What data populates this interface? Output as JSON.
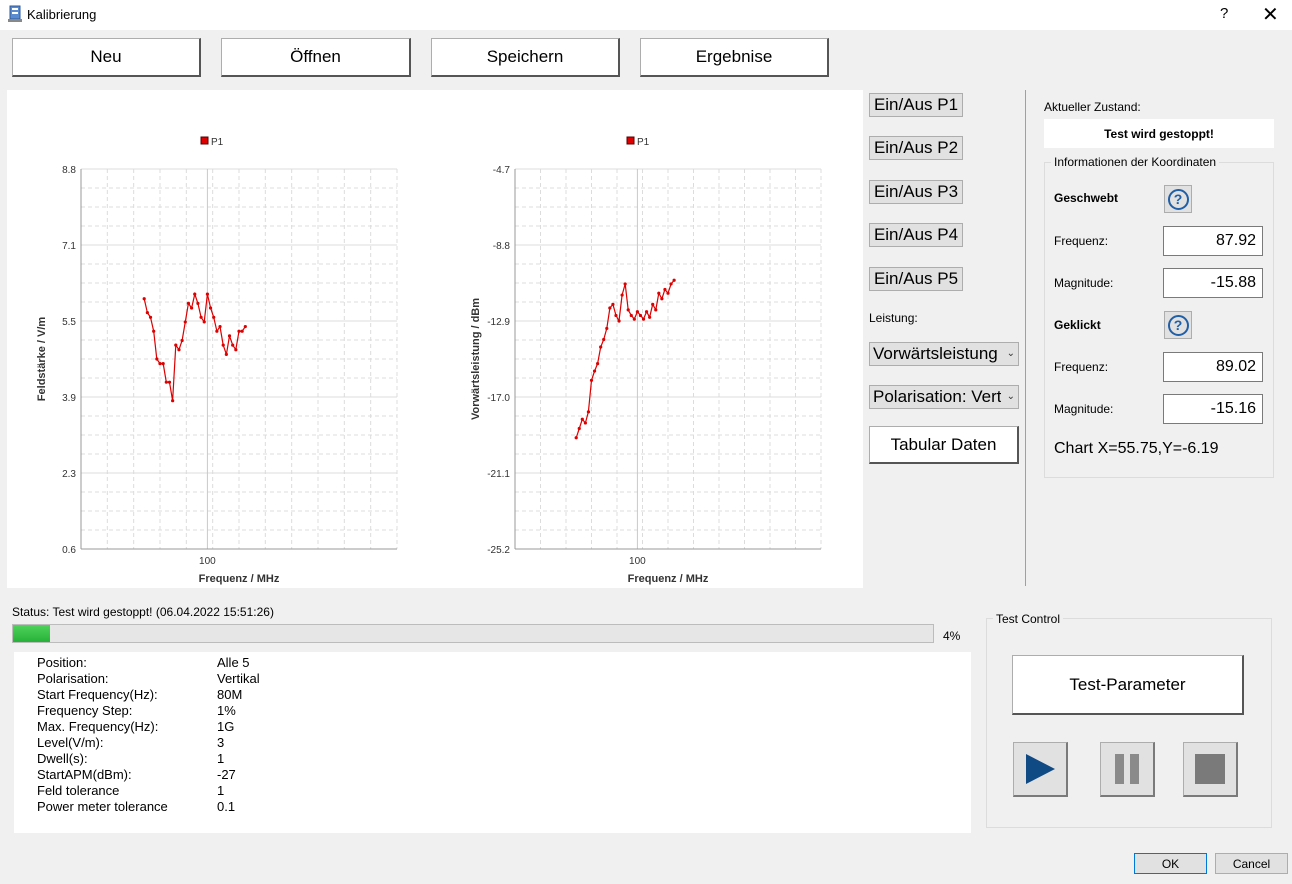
{
  "window": {
    "title": "Kalibrierung",
    "help": "?",
    "close": "✕"
  },
  "toolbar": {
    "new_label": "Neu",
    "open_label": "Öffnen",
    "save_label": "Speichern",
    "results_label": "Ergebnise"
  },
  "chart_data": [
    {
      "type": "line",
      "legend": "P1",
      "xlabel": "Frequenz / MHz",
      "ylabel": "Feldstärke / V/m",
      "x_ticks": [
        "100"
      ],
      "y_ticks": [
        "8.8",
        "7.1",
        "5.5",
        "3.9",
        "2.3",
        "0.6"
      ],
      "ylim": [
        0.6,
        8.8
      ],
      "series": [
        {
          "name": "P1",
          "color": "#dd0000",
          "x": [
            80,
            81,
            82,
            83,
            84,
            85,
            86,
            87,
            88,
            89,
            90,
            91,
            92,
            93,
            94,
            95,
            96,
            97,
            98,
            99,
            100,
            101,
            102,
            103,
            104,
            105,
            106,
            107,
            108,
            109,
            110,
            111,
            112
          ],
          "y": [
            6.0,
            5.7,
            5.6,
            5.3,
            4.7,
            4.6,
            4.6,
            4.2,
            4.2,
            3.8,
            5.0,
            4.9,
            5.1,
            5.5,
            5.9,
            5.8,
            6.1,
            5.9,
            5.6,
            5.5,
            6.1,
            5.8,
            5.6,
            5.3,
            5.4,
            5.0,
            4.8,
            5.2,
            5.0,
            4.9,
            5.3,
            5.3,
            5.4
          ]
        }
      ]
    },
    {
      "type": "line",
      "legend": "P1",
      "xlabel": "Frequenz / MHz",
      "ylabel": "Vorwärtsleistung / dBm",
      "x_ticks": [
        "100"
      ],
      "y_ticks": [
        "-4.7",
        "-8.8",
        "-12.9",
        "-17.0",
        "-21.1",
        "-25.2"
      ],
      "ylim": [
        -25.2,
        -4.7
      ],
      "series": [
        {
          "name": "P1",
          "color": "#dd0000",
          "x": [
            80,
            81,
            82,
            83,
            84,
            85,
            86,
            87,
            88,
            89,
            90,
            91,
            92,
            93,
            94,
            95,
            96,
            97,
            98,
            99,
            100,
            101,
            102,
            103,
            104,
            105,
            106,
            107,
            108,
            109,
            110,
            111,
            112
          ],
          "y": [
            -19.2,
            -18.7,
            -18.2,
            -18.4,
            -17.8,
            -16.1,
            -15.6,
            -15.2,
            -14.3,
            -13.9,
            -13.3,
            -12.2,
            -12.0,
            -12.6,
            -12.9,
            -11.5,
            -10.9,
            -12.3,
            -12.6,
            -12.8,
            -12.4,
            -12.6,
            -12.8,
            -12.4,
            -12.7,
            -12.0,
            -12.3,
            -11.4,
            -11.7,
            -11.2,
            -11.4,
            -10.9,
            -10.7
          ]
        }
      ]
    }
  ],
  "toggles": [
    "Ein/Aus P1",
    "Ein/Aus P2",
    "Ein/Aus P3",
    "Ein/Aus P4",
    "Ein/Aus P5"
  ],
  "leistung_label": "Leistung:",
  "power_combo": "Vorwärtsleistung",
  "polarisation_combo": "Polarisation: Vertikal",
  "tabular_label": "Tabular Daten",
  "state": {
    "label": "Aktueller Zustand:",
    "value": "Test wird gestoppt!"
  },
  "coords": {
    "group_title": "Informationen der Koordinaten",
    "hovered_label": "Geschwebt",
    "freq_label": "Frequenz:",
    "mag_label": "Magnitude:",
    "hovered_freq": "87.92",
    "hovered_mag": "-15.88",
    "clicked_label": "Geklickt",
    "clicked_freq": "89.02",
    "clicked_mag": "-15.16",
    "chart_xy": "Chart X=55.75,Y=-6.19"
  },
  "status": {
    "text": "Status: Test wird gestoppt! (06.04.2022 15:51:26)",
    "progress": 4,
    "progress_label": "4%"
  },
  "info": [
    [
      "Position:",
      "Alle 5"
    ],
    [
      "Polarisation:",
      "Vertikal"
    ],
    [
      "Start Frequency(Hz):",
      "80M"
    ],
    [
      "Frequency Step:",
      "1%"
    ],
    [
      "Max. Frequency(Hz):",
      "1G"
    ],
    [
      "Level(V/m):",
      "3"
    ],
    [
      "Dwell(s):",
      "1"
    ],
    [
      "StartAPM(dBm):",
      "-27"
    ],
    [
      "Feld tolerance",
      "1"
    ],
    [
      "Power meter tolerance",
      "0.1"
    ]
  ],
  "test_control": {
    "title": "Test Control",
    "params_label": "Test-Parameter"
  },
  "dialog": {
    "ok_label": "OK",
    "cancel_label": "Cancel"
  }
}
